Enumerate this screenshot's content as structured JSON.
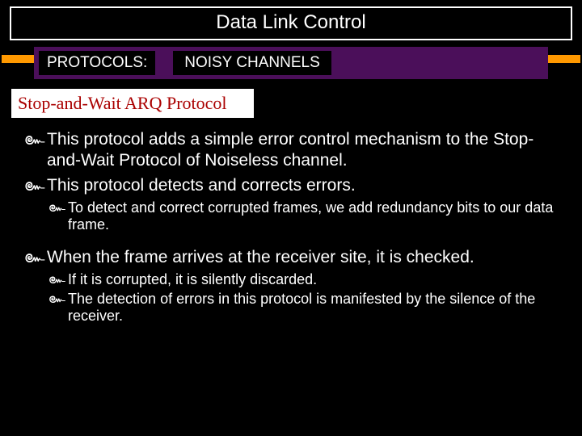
{
  "title": "Data Link Control",
  "subtitle": {
    "label": "PROTOCOLS:",
    "topic": "NOISY CHANNELS"
  },
  "section_header": "Stop-and-Wait ARQ Protocol",
  "bullets": {
    "b1": "This protocol adds a simple error control mechanism to the Stop-and-Wait Protocol of Noiseless channel.",
    "b2": "This protocol detects and corrects errors.",
    "b2a": "To detect and correct corrupted frames, we add redundancy bits to our data frame.",
    "b3": "When the frame arrives at the receiver site, it is checked.",
    "b3a": "If it is corrupted, it is silently discarded.",
    "b3b": "The detection of errors in this protocol is manifested by the silence of the receiver."
  },
  "glyph": "๛"
}
